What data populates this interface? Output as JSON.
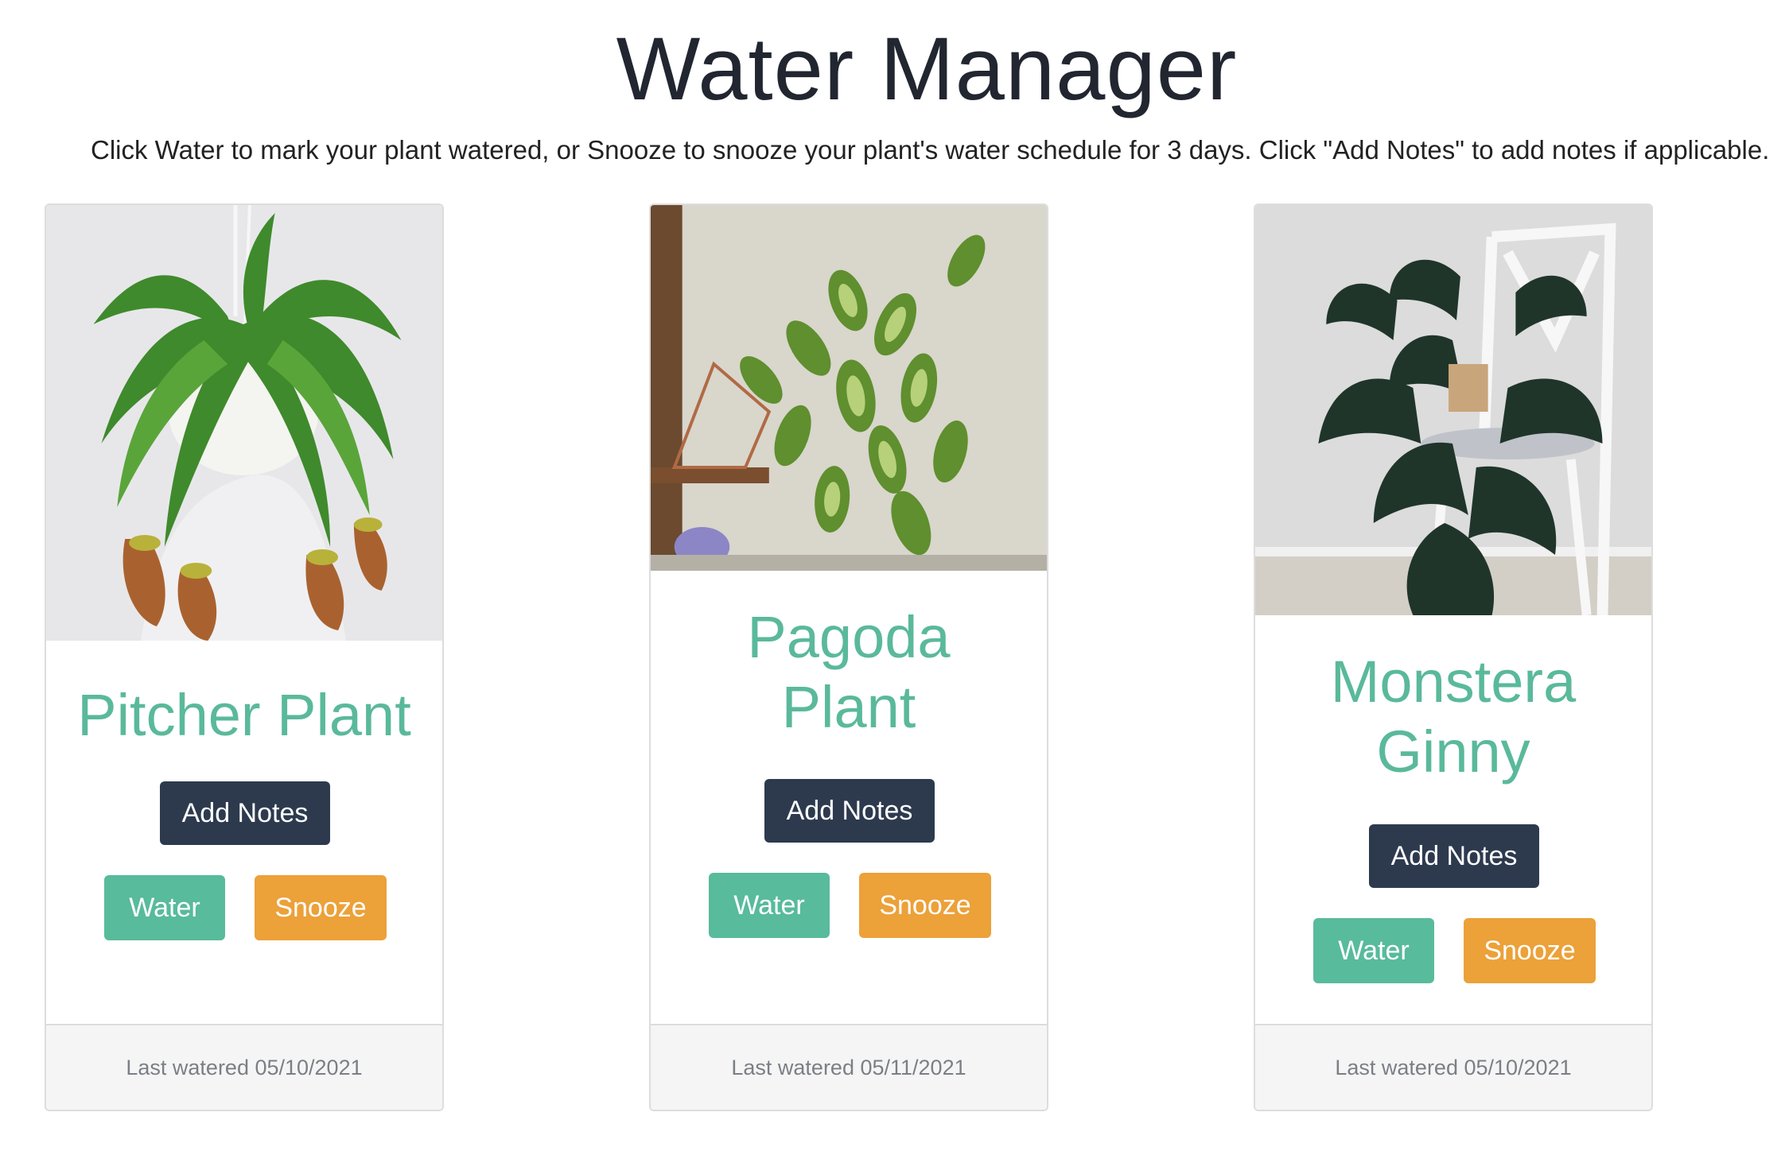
{
  "header": {
    "title": "Water Manager",
    "subtitle": "Click Water to mark your plant watered, or Snooze to snooze your plant's water schedule for 3 days. Click \"Add Notes\" to add notes if applicable."
  },
  "colors": {
    "plant_name": "#5ab99b",
    "add_notes_button": "#2d3a4e",
    "water_button": "#58bb9b",
    "snooze_button": "#eca139",
    "footer_bg": "#f5f5f5"
  },
  "plants": [
    {
      "name": "Pitcher Plant",
      "add_notes_label": "Add Notes",
      "water_label": "Water",
      "snooze_label": "Snooze",
      "last_watered": "Last watered 05/10/2021"
    },
    {
      "name_line1": "Pagoda",
      "name_line2": "Plant",
      "add_notes_label": "Add Notes",
      "water_label": "Water",
      "snooze_label": "Snooze",
      "last_watered": "Last watered 05/11/2021"
    },
    {
      "name_line1": "Monstera",
      "name_line2": "Ginny",
      "add_notes_label": "Add Notes",
      "water_label": "Water",
      "snooze_label": "Snooze",
      "last_watered": "Last watered 05/10/2021"
    }
  ]
}
